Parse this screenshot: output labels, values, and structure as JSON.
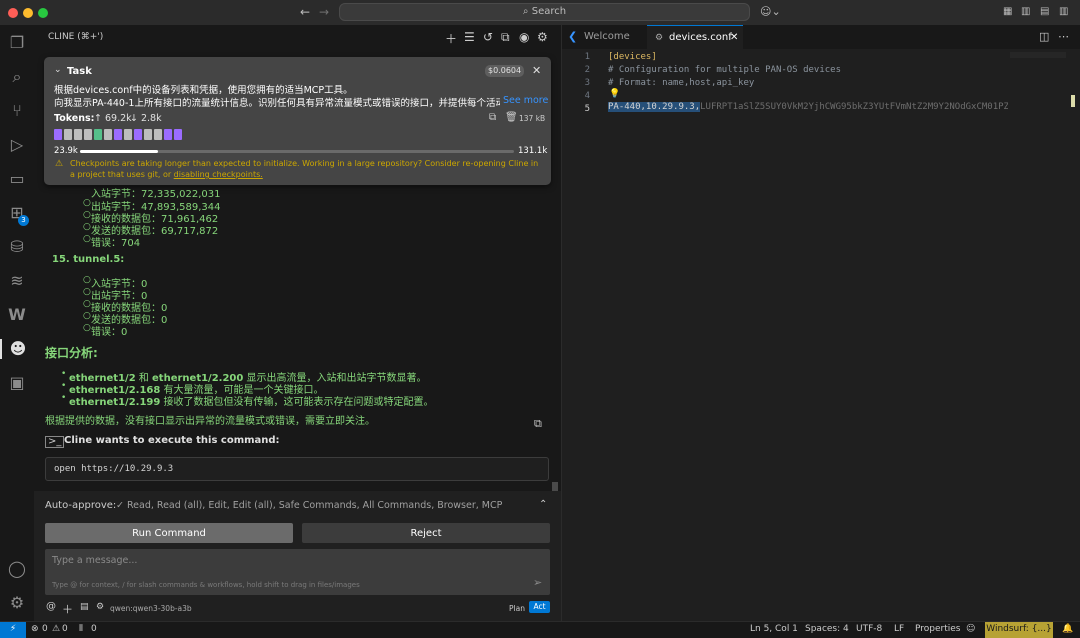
{
  "titlebar": {
    "search_placeholder": "Search"
  },
  "sidebar": {
    "header_title": "CLINE (⌘+')",
    "task": {
      "label": "Task",
      "cost": "$0.0604",
      "text_line1": "根据devices.conf中的设备列表和凭据，使用您拥有的适当MCP工具。",
      "text_line2": "向我显示PA-440-1上所有接口的流量统计信息。识别任何具有异常流量模式或错误的接口，并提供每个活动接",
      "see_more": "See more",
      "tokens_label": "Tokens:",
      "tokens_up": "↑ 69.2k",
      "tokens_down": "↓ 2.8k",
      "size": "137 kB",
      "context_used": "23.9k",
      "context_max": "131.1k",
      "context_fraction": 0.18,
      "checkpoint_warning": "Checkpoints are taking longer than expected to initialize. Working in a large repository? Consider re-opening Cline in a project that uses git, or",
      "checkpoint_link": "disabling checkpoints."
    },
    "partial_item_top": "入站字节：72,335,022,031",
    "prev_interface": {
      "items": [
        "出站字节：47,893,589,344",
        "接收的数据包：71,961,462",
        "发送的数据包：69,717,872",
        "错误：704"
      ]
    },
    "interface15": {
      "title": "15. tunnel.5:",
      "items": [
        "入站字节：0",
        "出站字节：0",
        "接收的数据包：0",
        "发送的数据包：0",
        "错误：0"
      ]
    },
    "analysis": {
      "heading": "接口分析:",
      "bullets": [
        {
          "bold": "ethernet1/2",
          "mid": " 和 ",
          "bold2": "ethernet1/2.200",
          "rest": " 显示出高流量，入站和出站字节数显著。"
        },
        {
          "bold": "ethernet1/2.168",
          "rest": " 有大量流量，可能是一个关键接口。"
        },
        {
          "bold": "ethernet1/2.199",
          "rest": " 接收了数据包但没有传输，这可能表示存在问题或特定配置。"
        }
      ],
      "conclusion": "根据提供的数据，没有接口显示出异常的流量模式或错误，需要立即关注。"
    },
    "command": {
      "title": "Cline wants to execute this command:",
      "code": "open https://10.29.9.3"
    },
    "auto_approve": {
      "label": "Auto-approve:",
      "value": "✓ Read, Read (all), Edit, Edit (all), Safe Commands, All Commands, Browser, MCP"
    },
    "run_button": "Run Command",
    "reject_button": "Reject",
    "message_placeholder": "Type a message...",
    "message_hint": "Type @ for context, / for slash commands & workflows, hold shift to drag in files/images",
    "model": "qwen:qwen3-30b-a3b",
    "plan_label": "Plan",
    "act_label": "Act",
    "badge_extensions": "3"
  },
  "editor": {
    "tabs": [
      {
        "label": "Welcome"
      },
      {
        "label": "devices.conf"
      }
    ],
    "lines": [
      {
        "no": "1",
        "text": "[devices]"
      },
      {
        "no": "2",
        "text": "# Configuration for multiple PAN-OS devices"
      },
      {
        "no": "3",
        "text": "# Format: name,host,api_key"
      },
      {
        "no": "4",
        "text": ""
      },
      {
        "no": "5",
        "text": "PA-440,10.29.9.3,",
        "rest": "LUFRPT1aSlZ5SUY0VkM2YjhCWG95bkZ3YUtFVmNtZ2M9Y2NOdGxCM01PZEhRc"
      }
    ]
  },
  "statusbar": {
    "problems_errors": "0",
    "problems_warnings": "0",
    "ports": "0",
    "position": "Ln 5, Col 1",
    "spaces": "Spaces: 4",
    "encoding": "UTF-8",
    "eol": "LF",
    "language": "Properties",
    "windsurf": "Windsurf: {...}"
  },
  "colors": {
    "accent": "#0078d4",
    "green_text": "#86d67a",
    "link": "#3794ff",
    "warning": "#cca700",
    "windsurf_bg": "#b7a234"
  }
}
